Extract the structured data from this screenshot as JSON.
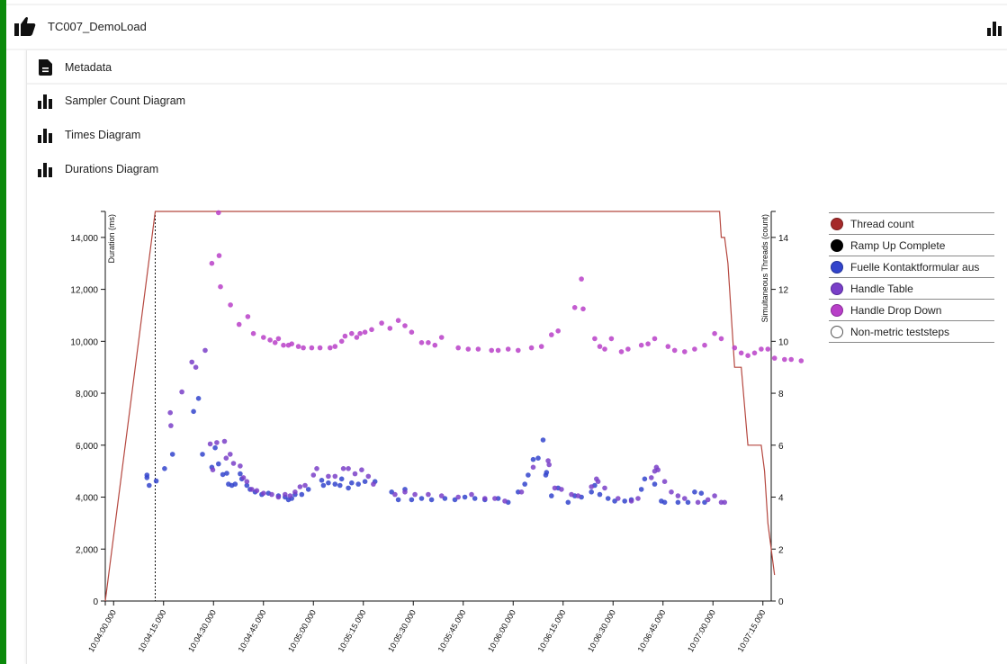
{
  "header": {
    "title": "TC007_DemoLoad",
    "status_icon": "thumbs-up-icon",
    "chart_toggle_icon": "bar-chart-icon"
  },
  "menu": [
    {
      "label": "Metadata",
      "icon": "document-icon"
    },
    {
      "label": "Sampler Count Diagram",
      "icon": "bar-chart-icon"
    },
    {
      "label": "Times Diagram",
      "icon": "bar-chart-icon"
    },
    {
      "label": "Durations Diagram",
      "icon": "bar-chart-icon"
    }
  ],
  "colors": {
    "accent_green": "#0b8a0b",
    "thread_count": "#a52a2a",
    "ramp_up": "#000000",
    "fuelle": "#3344cc",
    "handle_table": "#7a3fc8",
    "handle_drop_down": "#b83fc8",
    "non_metric": "#ffffff"
  },
  "legend": [
    {
      "label": "Thread count",
      "color": "#a52a2a",
      "border": "#a52a2a"
    },
    {
      "label": "Ramp Up Complete",
      "color": "#000000",
      "border": "#000000"
    },
    {
      "label": "Fuelle Kontaktformular aus",
      "color": "#3344cc",
      "border": "#3344cc"
    },
    {
      "label": "Handle Table",
      "color": "#7a3fc8",
      "border": "#7a3fc8"
    },
    {
      "label": "Handle Drop Down",
      "color": "#b83fc8",
      "border": "#b83fc8"
    },
    {
      "label": "Non-metric teststeps",
      "color": "#ffffff",
      "border": "#555555"
    }
  ],
  "chart_data": {
    "type": "scatter",
    "title": "Durations Diagram",
    "xlabel": "",
    "ylabel": "Duration (ms)",
    "y2label": "Simultaneous Threads (count)",
    "xlim_seconds": [
      0,
      200
    ],
    "x_origin": "10:04:00.000",
    "ylim": [
      0,
      15000
    ],
    "y2lim": [
      0,
      15
    ],
    "yticks": [
      0,
      2000,
      4000,
      6000,
      8000,
      10000,
      12000,
      14000
    ],
    "ytick_labels": [
      "0",
      "2,000",
      "4,000",
      "6,000",
      "8,000",
      "10,000",
      "12,000",
      "14,000"
    ],
    "y2ticks": [
      0,
      2,
      4,
      6,
      8,
      10,
      12,
      14
    ],
    "y2tick_labels": [
      "0",
      "2",
      "4",
      "6",
      "8",
      "10",
      "12",
      "14"
    ],
    "xticks_seconds": [
      2.5,
      17.5,
      32.5,
      47.5,
      62.5,
      77.5,
      92.5,
      107.5,
      122.5,
      137.5,
      152.5,
      167.5,
      182.5,
      197.5
    ],
    "xtick_labels": [
      "10:04:00.000",
      "10:04:15.000",
      "10:04:30.000",
      "10:04:45.000",
      "10:05:00.000",
      "10:05:15.000",
      "10:05:30.000",
      "10:05:45.000",
      "10:06:00.000",
      "10:06:15.000",
      "10:06:30.000",
      "10:06:45.000",
      "10:07:00.000",
      "10:07:15.000"
    ],
    "grid": false,
    "legend_position": "right",
    "ramp_up_complete_seconds": 15,
    "thread_count": {
      "name": "Thread count",
      "points": [
        [
          0,
          0
        ],
        [
          15,
          15
        ],
        [
          184.5,
          15
        ],
        [
          185,
          14
        ],
        [
          186,
          14
        ],
        [
          187,
          13
        ],
        [
          189,
          9
        ],
        [
          191,
          9
        ],
        [
          193,
          6
        ],
        [
          197,
          6
        ],
        [
          198,
          5
        ],
        [
          199,
          3
        ],
        [
          201,
          1
        ]
      ]
    },
    "series": [
      {
        "name": "Fuelle Kontaktformular aus",
        "color": "#3344cc",
        "points": [
          [
            12.5,
            4850
          ],
          [
            12.5,
            4750
          ],
          [
            13.2,
            4450
          ],
          [
            15.3,
            4620
          ],
          [
            17.8,
            5100
          ],
          [
            20.2,
            5650
          ],
          [
            26.5,
            7300
          ],
          [
            28,
            7800
          ],
          [
            29.2,
            5650
          ],
          [
            32,
            5150
          ],
          [
            33,
            5900
          ],
          [
            34,
            5280
          ],
          [
            35.3,
            4870
          ],
          [
            36.5,
            4920
          ],
          [
            37,
            4500
          ],
          [
            38,
            4450
          ],
          [
            39,
            4500
          ],
          [
            40.5,
            4900
          ],
          [
            41,
            4700
          ],
          [
            42.5,
            4450
          ],
          [
            43.5,
            4300
          ],
          [
            45,
            4200
          ],
          [
            47,
            4100
          ],
          [
            49,
            4150
          ],
          [
            52,
            4050
          ],
          [
            54,
            4000
          ],
          [
            55,
            3900
          ],
          [
            56,
            3950
          ],
          [
            57,
            4100
          ],
          [
            59,
            4100
          ],
          [
            61,
            4300
          ],
          [
            65,
            4650
          ],
          [
            65.5,
            4450
          ],
          [
            67,
            4550
          ],
          [
            69,
            4500
          ],
          [
            70.5,
            4450
          ],
          [
            71,
            4700
          ],
          [
            73,
            4350
          ],
          [
            74,
            4550
          ],
          [
            76,
            4500
          ],
          [
            78,
            4600
          ],
          [
            81,
            4600
          ],
          [
            86,
            4200
          ],
          [
            88,
            3900
          ],
          [
            90,
            4300
          ],
          [
            92,
            3900
          ],
          [
            95,
            3950
          ],
          [
            98,
            3900
          ],
          [
            102,
            3950
          ],
          [
            105,
            3900
          ],
          [
            108,
            4000
          ],
          [
            111,
            3950
          ],
          [
            114,
            3900
          ],
          [
            118,
            3950
          ],
          [
            121,
            3800
          ],
          [
            124,
            4200
          ],
          [
            126,
            4500
          ],
          [
            127,
            4850
          ],
          [
            128.5,
            5450
          ],
          [
            130,
            5500
          ],
          [
            131.5,
            6200
          ],
          [
            132.3,
            4850
          ],
          [
            132.5,
            4950
          ],
          [
            134,
            4050
          ],
          [
            136,
            4350
          ],
          [
            139,
            3800
          ],
          [
            141,
            4050
          ],
          [
            143,
            4000
          ],
          [
            146,
            4200
          ],
          [
            147,
            4450
          ],
          [
            148.5,
            4100
          ],
          [
            151,
            3950
          ],
          [
            153,
            3850
          ],
          [
            156,
            3850
          ],
          [
            158,
            3900
          ],
          [
            161,
            4300
          ],
          [
            162,
            4700
          ],
          [
            165,
            4500
          ],
          [
            167,
            3850
          ],
          [
            168,
            3800
          ],
          [
            172,
            3800
          ],
          [
            175,
            3800
          ],
          [
            177,
            4200
          ],
          [
            179,
            4150
          ],
          [
            180,
            3800
          ]
        ]
      },
      {
        "name": "Handle Table",
        "color": "#7a3fc8",
        "points": [
          [
            19.5,
            7250
          ],
          [
            19.7,
            6750
          ],
          [
            23,
            8050
          ],
          [
            26,
            9200
          ],
          [
            27.2,
            9000
          ],
          [
            30,
            9650
          ],
          [
            31.5,
            6050
          ],
          [
            32.3,
            5050
          ],
          [
            33.5,
            6100
          ],
          [
            35.8,
            6150
          ],
          [
            36.3,
            5500
          ],
          [
            37.5,
            5650
          ],
          [
            38.5,
            5300
          ],
          [
            40.5,
            5200
          ],
          [
            41.5,
            4750
          ],
          [
            42.5,
            4600
          ],
          [
            44,
            4300
          ],
          [
            45.5,
            4250
          ],
          [
            47.5,
            4150
          ],
          [
            50,
            4100
          ],
          [
            52,
            4000
          ],
          [
            54,
            4100
          ],
          [
            55.5,
            4050
          ],
          [
            57,
            4200
          ],
          [
            58.5,
            4400
          ],
          [
            60,
            4450
          ],
          [
            62.5,
            4850
          ],
          [
            63.5,
            5100
          ],
          [
            67,
            4800
          ],
          [
            69,
            4800
          ],
          [
            71.5,
            5100
          ],
          [
            73,
            5100
          ],
          [
            75,
            4900
          ],
          [
            77,
            5050
          ],
          [
            79,
            4800
          ],
          [
            80.5,
            4500
          ],
          [
            87,
            4100
          ],
          [
            90,
            4200
          ],
          [
            93,
            4100
          ],
          [
            97,
            4100
          ],
          [
            101,
            4050
          ],
          [
            106,
            4000
          ],
          [
            110,
            4100
          ],
          [
            114,
            3950
          ],
          [
            117,
            3950
          ],
          [
            120,
            3850
          ],
          [
            125,
            4200
          ],
          [
            128.5,
            5150
          ],
          [
            133,
            5400
          ],
          [
            133.3,
            5250
          ],
          [
            135,
            4350
          ],
          [
            137,
            4300
          ],
          [
            140,
            4100
          ],
          [
            142,
            4050
          ],
          [
            146,
            4400
          ],
          [
            147.5,
            4700
          ],
          [
            148,
            4600
          ],
          [
            150,
            4350
          ],
          [
            154,
            3950
          ],
          [
            158,
            3850
          ],
          [
            160,
            3950
          ],
          [
            164,
            4750
          ],
          [
            165,
            5000
          ],
          [
            165.5,
            5150
          ],
          [
            166,
            5050
          ],
          [
            168,
            4600
          ],
          [
            170,
            4200
          ],
          [
            172,
            4050
          ],
          [
            174,
            3950
          ],
          [
            178,
            3800
          ],
          [
            181,
            3900
          ],
          [
            183,
            4050
          ],
          [
            185,
            3800
          ],
          [
            186,
            3800
          ]
        ]
      },
      {
        "name": "Handle Drop Down",
        "color": "#b83fc8",
        "points": [
          [
            32,
            13000
          ],
          [
            34,
            14950
          ],
          [
            34.2,
            13300
          ],
          [
            34.6,
            12100
          ],
          [
            37.6,
            11400
          ],
          [
            40.2,
            10650
          ],
          [
            42.8,
            10950
          ],
          [
            44.5,
            10300
          ],
          [
            47.5,
            10150
          ],
          [
            49.5,
            10050
          ],
          [
            51,
            9950
          ],
          [
            52,
            10100
          ],
          [
            53.5,
            9850
          ],
          [
            55,
            9850
          ],
          [
            56,
            9900
          ],
          [
            58,
            9800
          ],
          [
            59.5,
            9750
          ],
          [
            62,
            9750
          ],
          [
            64.5,
            9750
          ],
          [
            67.5,
            9750
          ],
          [
            69,
            9800
          ],
          [
            71,
            10000
          ],
          [
            72,
            10200
          ],
          [
            74,
            10300
          ],
          [
            75.5,
            10150
          ],
          [
            76.5,
            10300
          ],
          [
            78,
            10350
          ],
          [
            80,
            10450
          ],
          [
            83,
            10700
          ],
          [
            85.5,
            10500
          ],
          [
            88,
            10800
          ],
          [
            90,
            10600
          ],
          [
            92,
            10350
          ],
          [
            95,
            9950
          ],
          [
            97,
            9950
          ],
          [
            99,
            9850
          ],
          [
            101,
            10150
          ],
          [
            106,
            9750
          ],
          [
            109,
            9700
          ],
          [
            112,
            9700
          ],
          [
            116,
            9650
          ],
          [
            118,
            9650
          ],
          [
            121,
            9700
          ],
          [
            124,
            9650
          ],
          [
            128,
            9750
          ],
          [
            131,
            9800
          ],
          [
            134,
            10250
          ],
          [
            136,
            10400
          ],
          [
            141,
            11300
          ],
          [
            143,
            12400
          ],
          [
            143.5,
            11250
          ],
          [
            147,
            10100
          ],
          [
            148.5,
            9800
          ],
          [
            150,
            9700
          ],
          [
            152,
            10100
          ],
          [
            155,
            9600
          ],
          [
            157,
            9700
          ],
          [
            161,
            9850
          ],
          [
            163,
            9900
          ],
          [
            165,
            10100
          ],
          [
            169,
            9800
          ],
          [
            171,
            9650
          ],
          [
            174,
            9600
          ],
          [
            177,
            9700
          ],
          [
            180,
            9850
          ],
          [
            183,
            10300
          ],
          [
            185,
            10100
          ],
          [
            189,
            9750
          ],
          [
            191,
            9550
          ],
          [
            193,
            9450
          ],
          [
            195,
            9550
          ],
          [
            197,
            9700
          ],
          [
            199,
            9700
          ],
          [
            201,
            9350
          ],
          [
            204,
            9300
          ],
          [
            206,
            9300
          ],
          [
            209,
            9250
          ]
        ]
      }
    ]
  }
}
